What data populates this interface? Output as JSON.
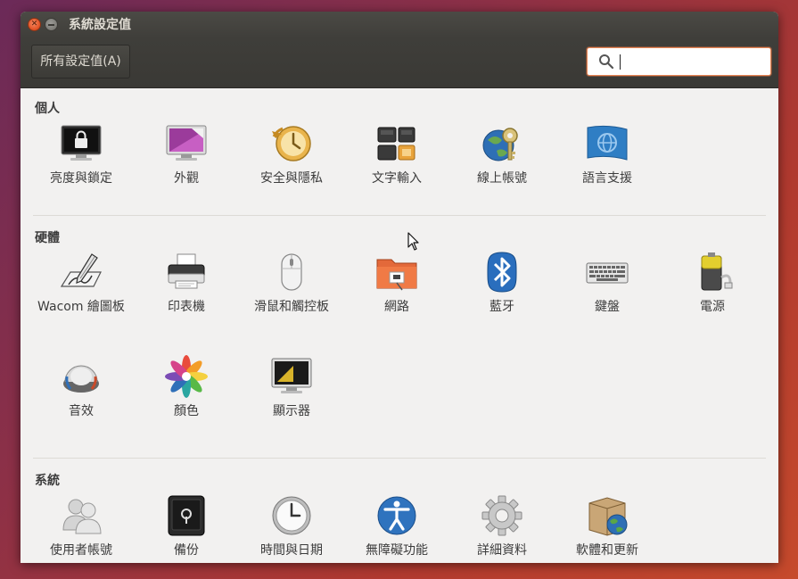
{
  "window": {
    "title": "系統設定值"
  },
  "toolbar": {
    "all_settings_label": "所有設定值(A)",
    "search_value": ""
  },
  "sections": {
    "personal": {
      "title": "個人",
      "items": [
        {
          "label": "亮度與鎖定",
          "icon": "lock-screen-icon"
        },
        {
          "label": "外觀",
          "icon": "appearance-icon"
        },
        {
          "label": "安全與隱私",
          "icon": "security-privacy-icon"
        },
        {
          "label": "文字輸入",
          "icon": "text-entry-icon"
        },
        {
          "label": "線上帳號",
          "icon": "online-accounts-icon"
        },
        {
          "label": "語言支援",
          "icon": "language-support-icon"
        }
      ]
    },
    "hardware": {
      "title": "硬體",
      "items": [
        {
          "label": "Wacom 繪圖板",
          "icon": "wacom-tablet-icon"
        },
        {
          "label": "印表機",
          "icon": "printer-icon"
        },
        {
          "label": "滑鼠和觸控板",
          "icon": "mouse-icon"
        },
        {
          "label": "網路",
          "icon": "network-icon"
        },
        {
          "label": "藍牙",
          "icon": "bluetooth-icon"
        },
        {
          "label": "鍵盤",
          "icon": "keyboard-icon"
        },
        {
          "label": "電源",
          "icon": "power-icon"
        },
        {
          "label": "音效",
          "icon": "sound-icon"
        },
        {
          "label": "顏色",
          "icon": "color-icon"
        },
        {
          "label": "顯示器",
          "icon": "displays-icon"
        }
      ]
    },
    "system": {
      "title": "系統",
      "items": [
        {
          "label": "使用者帳號",
          "icon": "user-accounts-icon"
        },
        {
          "label": "備份",
          "icon": "backup-icon"
        },
        {
          "label": "時間與日期",
          "icon": "time-date-icon"
        },
        {
          "label": "無障礙功能",
          "icon": "accessibility-icon"
        },
        {
          "label": "詳細資料",
          "icon": "details-icon"
        },
        {
          "label": "軟體和更新",
          "icon": "software-updates-icon"
        }
      ]
    }
  }
}
